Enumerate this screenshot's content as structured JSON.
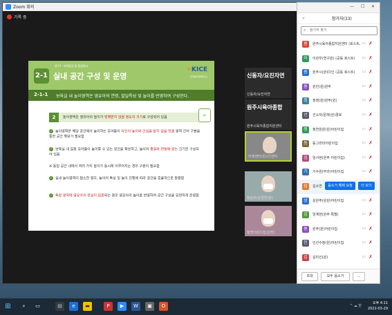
{
  "zoom": {
    "window_title": "Zoom 회의",
    "recording_label": "기록 중"
  },
  "slide": {
    "small_header": "연구1. 보육환경 및 환경관리",
    "section_number": "2-1",
    "title": "실내 공간 구성 및 운영",
    "logo": "KICE",
    "logo_sub": "한국육아정책연구소",
    "sub_number": "2-1-1",
    "sub_title": "보육실 내 놀이영역은 영유아의 연령, 발달특성 및 놀이를 반영하여 구성한다.",
    "section2_number": "2",
    "section2_text_pre": "놀이영역은 영유아의 놀이가 ",
    "section2_text_red": "방해받지 않을 정도의 크기",
    "section2_text_post": "로 구성되어 있음",
    "bullets": [
      {
        "text_pre": "놀이영역은 해당 공간에서 놀이하는 유아들이 ",
        "text_red": "타인의 놀이와 간섭을 받지 않을 만큼",
        "text_post": " 영역 간의 구분을 통한 공간 확보가 필요함"
      },
      {
        "text_pre": "보육실 내 일정 유아들이 놀이할 수 있는 공간을 확보하고, 놀이의 ",
        "text_red": "종류와 연령에 맞는",
        "text_post": " 크기로 구성되어 있음"
      },
      {
        "text_pre": "",
        "text_red": "",
        "text_post": "※ 동일 공간 내에서 여러 가지 놀이가 동시에 이루어지는 경우 구분이 필요함"
      },
      {
        "text_pre": "실내 놀이영역이 협소한 경우, 놀이의 ",
        "text_red": "",
        "text_post": "특성 및 놀이 진행에 따라 공간을 효율적으로 활용함"
      },
      {
        "text_pre": "",
        "text_red": "특정 영역에 영유아의 관심이 집중",
        "text_post": "되는 경우 영유아의 놀이를 반영하여 공간 구성을 유연하게 운영함"
      }
    ]
  },
  "gallery": [
    {
      "big": "신동자/요진자연",
      "name": "신동자/요진자연"
    },
    {
      "big": "원주시육아종합",
      "name": "원주시육아종합지원센터"
    },
    {
      "big": "",
      "name": "미래센터(원)/인센터"
    },
    {
      "big": "",
      "name": "청순라/삼경연(청)"
    },
    {
      "big": "",
      "name": "청명어린이집(원장)"
    }
  ],
  "panel": {
    "title": "참가자(33)",
    "search_placeholder": "참가자 찾기",
    "participants": [
      {
        "name": "원주시육아종합지원센터 (호스트, 나)",
        "initial": "원",
        "color": "#d24a3a"
      },
      {
        "name": "이관우(연구원) (공동 호스트)",
        "initial": "이",
        "color": "#2f9a5a"
      },
      {
        "name": "원주시(원)다인 (공동 호스트)",
        "initial": "원",
        "color": "#2d6fd0"
      },
      {
        "name": "원진(원)원주",
        "initial": "원",
        "color": "#8a4fc2"
      },
      {
        "name": "정영(원)원주(원)",
        "initial": "정",
        "color": "#3e7e9a"
      },
      {
        "name": "선소자/문래(원)경로",
        "initial": "선",
        "color": "#555a6b"
      },
      {
        "name": "청연원원(원)어린이집",
        "initial": "청",
        "color": "#2f9a5a"
      },
      {
        "name": "동그라미어린이집",
        "initial": "동",
        "color": "#7b6a3e"
      },
      {
        "name": "임서현(원주 어린이집)",
        "initial": "임",
        "color": "#b04e7a"
      },
      {
        "name": "기수원(무과)어린이집",
        "initial": "기",
        "color": "#3a6fb0"
      },
      {
        "name": "김소연",
        "initial": "김",
        "color": "#e07d2b"
      },
      {
        "name": "상원주(원원)어린이집",
        "initial": "상",
        "color": "#2d6fd0"
      },
      {
        "name": "임계현(원주 특별)",
        "initial": "임",
        "color": "#4c9a3a"
      },
      {
        "name": "원주(원)어린이집",
        "initial": "원",
        "color": "#8a4fc2"
      },
      {
        "name": "인선수정(원)어린이집",
        "initial": "인",
        "color": "#555a6b"
      },
      {
        "name": "김미선(원)",
        "initial": "김",
        "color": "#c44646"
      }
    ],
    "hover_unmute": "음소거 해제 요청",
    "hover_more": "더 보기",
    "invite_label": "초대",
    "mute_all_label": "모두 음소거",
    "more_label": "..."
  },
  "taskbar": {
    "time": "오후 4:11",
    "date": "2022-03-29",
    "tray": "^ ☁ 한"
  }
}
